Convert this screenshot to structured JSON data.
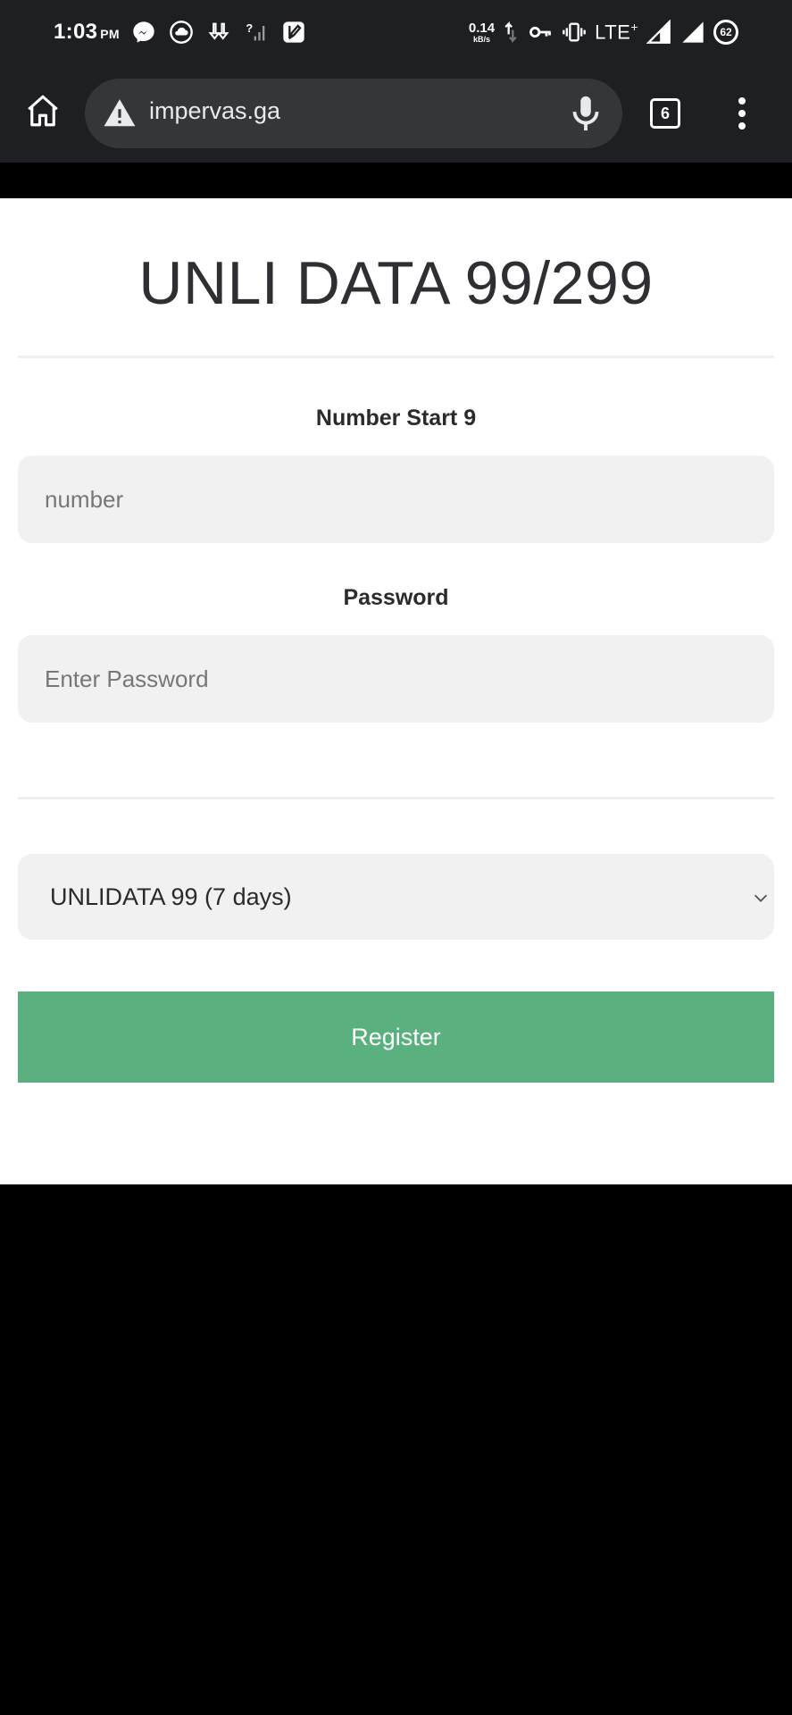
{
  "status_bar": {
    "time": "1:03",
    "ampm": "PM",
    "speed_value": "0.14",
    "speed_unit": "kB/s",
    "network": "LTE",
    "network_plus": "+",
    "battery": "62",
    "icons": [
      "messenger-icon",
      "cloud-sync-icon",
      "download-icon",
      "no-signal-icon",
      "edit-app-icon",
      "data-transfer-icon",
      "vpn-key-icon",
      "vibrate-icon",
      "signal-icon",
      "signal-icon"
    ]
  },
  "browser": {
    "url": "impervas.ga",
    "tab_count": "6",
    "icons": [
      "home-icon",
      "warning-icon",
      "mic-icon",
      "tabs-icon",
      "more-vert-icon"
    ]
  },
  "form": {
    "title": "UNLI DATA 99/299",
    "number_label": "Number Start 9",
    "number_placeholder": "number",
    "password_label": "Password",
    "password_placeholder": "Enter Password",
    "plan_selected": "UNLIDATA 99 (7 days)",
    "register_label": "Register"
  },
  "colors": {
    "chrome_bg": "#1e1f22",
    "url_box": "#35363a",
    "input_bg": "#f1f1f1",
    "button": "#5ab07f",
    "warning": "#e8eaed"
  }
}
